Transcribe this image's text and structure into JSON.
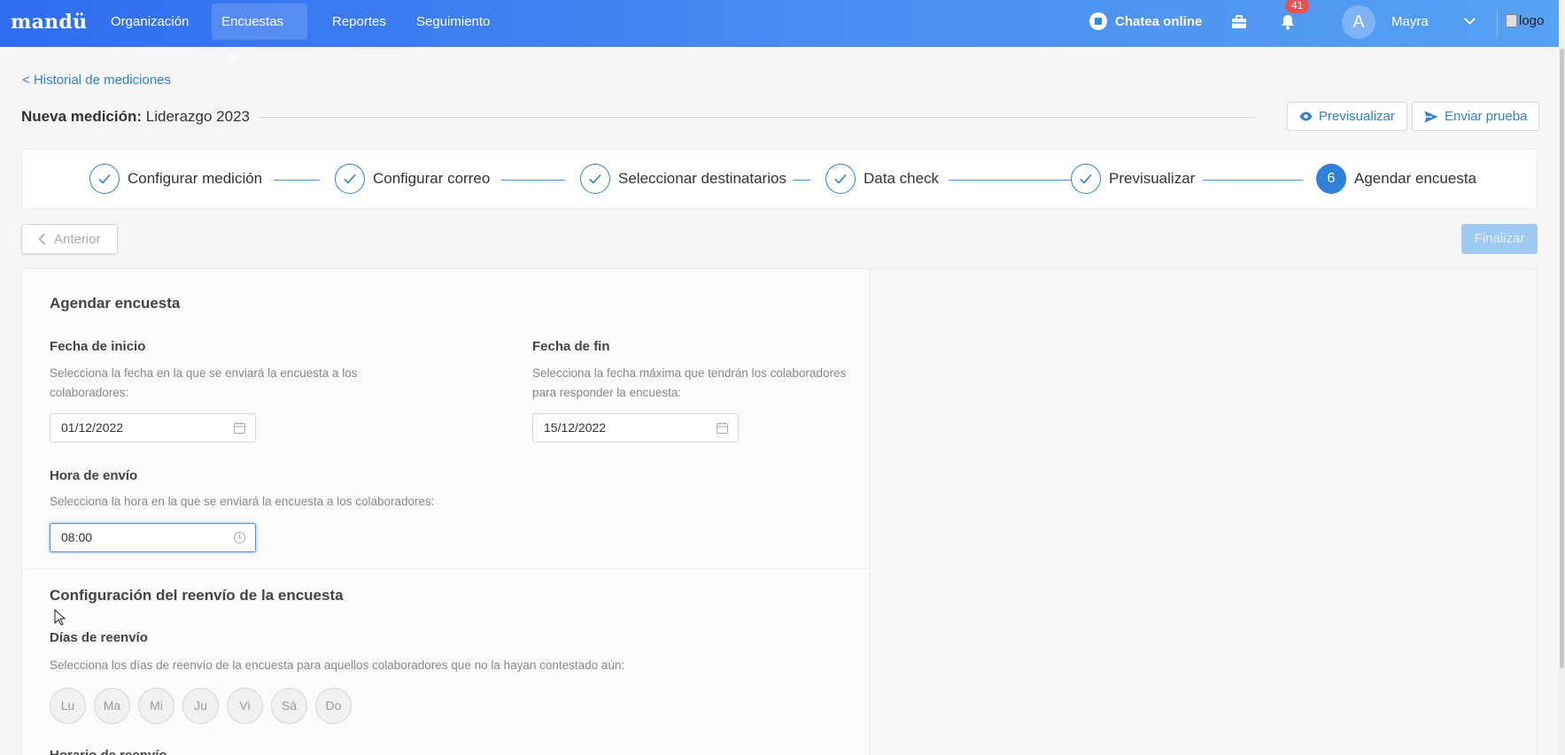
{
  "topbar": {
    "brand": "mandü",
    "nav": [
      {
        "label": "Organización"
      },
      {
        "label": "Encuestas"
      },
      {
        "label": "Reportes"
      },
      {
        "label": "Seguimiento"
      }
    ],
    "chat_label": "Chatea online",
    "notification_count": "41",
    "avatar_initial": "A",
    "user_name": "Mayra",
    "logo_alt": "logo"
  },
  "header": {
    "back_link": "Historial de mediciones",
    "title_prefix": "Nueva medición:",
    "title_name": "Liderazgo 2023",
    "preview_button": "Previsualizar",
    "send_test_button": "Enviar prueba"
  },
  "stepper": {
    "steps": [
      {
        "label": "Configurar medición",
        "status": "done"
      },
      {
        "label": "Configurar correo",
        "status": "done"
      },
      {
        "label": "Seleccionar destinatarios",
        "status": "done"
      },
      {
        "label": "Data check",
        "status": "done"
      },
      {
        "label": "Previsualizar",
        "status": "done"
      },
      {
        "label": "Agendar encuesta",
        "status": "active",
        "number": "6"
      }
    ]
  },
  "actions": {
    "prev_label": "Anterior",
    "finish_label": "Finalizar"
  },
  "schedule": {
    "title": "Agendar encuesta",
    "start": {
      "label": "Fecha de inicio",
      "help": "Selecciona la fecha en la que se enviará la encuesta a los colaboradores:",
      "value": "01/12/2022"
    },
    "end": {
      "label": "Fecha de fin",
      "help": "Selecciona la fecha máxima que tendrán los colaboradores para responder la encuesta:",
      "value": "15/12/2022"
    },
    "time": {
      "label": "Hora de envío",
      "help": "Selecciona la hora en la que se enviará la encuesta a los colaboradores:",
      "value": "08:00"
    }
  },
  "resend": {
    "title": "Configuración del reenvío de la encuesta",
    "days_label": "Días de reenvío",
    "days_help": "Selecciona los días de reenvío de la encuesta para aquellos colaboradores que no la hayan contestado aún:",
    "days": [
      "Lu",
      "Ma",
      "Mi",
      "Ju",
      "Vi",
      "Sá",
      "Do"
    ],
    "schedule_label": "Horario de reenvío"
  },
  "colors": {
    "primary": "#2f80d8",
    "topbar_start": "#2f6df0",
    "topbar_end": "#57a0f3",
    "badge": "#e9524f"
  }
}
